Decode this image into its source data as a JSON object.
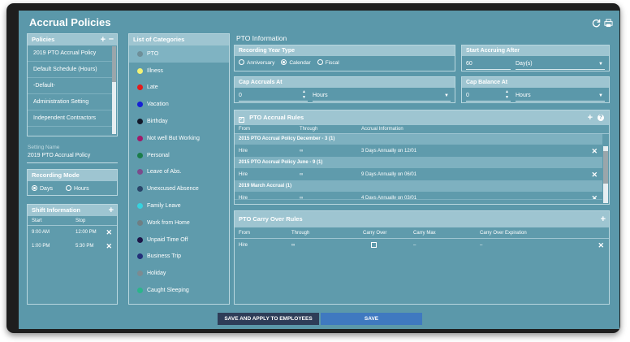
{
  "app": {
    "title": "Accrual Policies"
  },
  "policies": {
    "title": "Policies",
    "items": [
      "2019 PTO Accrual Policy",
      "Default Schedule (Hours)",
      "-Default-",
      "Administration Setting",
      "Independent Contractors"
    ]
  },
  "setting": {
    "label": "Setting Name",
    "value": "2019 PTO Accrual Policy"
  },
  "recording_mode": {
    "title": "Recording Mode",
    "options": [
      "Days",
      "Hours"
    ],
    "selected": "Days"
  },
  "shift_info": {
    "title": "Shift Information",
    "columns": [
      "Start",
      "Stop"
    ],
    "rows": [
      {
        "start": "9:00 AM",
        "stop": "12:00 PM"
      },
      {
        "start": "1:00 PM",
        "stop": "5:30 PM"
      }
    ]
  },
  "categories": {
    "title": "List of Categories",
    "items": [
      {
        "label": "PTO",
        "color": "#6e8f99"
      },
      {
        "label": "Illness",
        "color": "#f2f275"
      },
      {
        "label": "Late",
        "color": "#e41b1b"
      },
      {
        "label": "Vacation",
        "color": "#1520d6"
      },
      {
        "label": "Birthday",
        "color": "#121829"
      },
      {
        "label": "Not well But Working",
        "color": "#a01a6a"
      },
      {
        "label": "Personal",
        "color": "#1b7d4a"
      },
      {
        "label": "Leave of Abs.",
        "color": "#7b4b8c"
      },
      {
        "label": "Unexcused Absence",
        "color": "#2a466a"
      },
      {
        "label": "Family Leave",
        "color": "#35d3df"
      },
      {
        "label": "Work from Home",
        "color": "#6f7f84"
      },
      {
        "label": "Unpaid Time Off",
        "color": "#1d1648"
      },
      {
        "label": "Business Trip",
        "color": "#23307a"
      },
      {
        "label": "Holiday",
        "color": "#7c8b92"
      },
      {
        "label": "Caught Sleeping",
        "color": "#2bb58a"
      }
    ]
  },
  "pto_info": {
    "title": "PTO Information",
    "recording_year_type": {
      "label": "Recording Year Type",
      "options": [
        "Anniversary",
        "Calendar",
        "Fiscal"
      ],
      "selected": "Calendar"
    },
    "start_accruing_after": {
      "label": "Start Accruing After",
      "value": "60",
      "unit": "Day(s)"
    },
    "cap_accruals_at": {
      "label": "Cap Accruals At",
      "value": "0",
      "unit": "Hours"
    },
    "cap_balance_at": {
      "label": "Cap Balance At",
      "value": "0",
      "unit": "Hours"
    }
  },
  "accrual_rules": {
    "title": "PTO Accrual Rules",
    "columns": [
      "From",
      "Through",
      "Accrual Information"
    ],
    "groups": [
      {
        "name": "2015 PTO Accrual Policy December - 3 (1)",
        "from": "Hire",
        "through": "∞",
        "info": "3 Days Annually on 12/01"
      },
      {
        "name": "2015 PTO Accrual Policy June - 9 (1)",
        "from": "Hire",
        "through": "∞",
        "info": "9 Days Annually on 06/01"
      },
      {
        "name": "2019 March Accrual (1)",
        "from": "Hire",
        "through": "∞",
        "info": "4 Days Annually on 03/01"
      }
    ]
  },
  "carry_over": {
    "title": "PTO Carry Over Rules",
    "columns": [
      "From",
      "Through",
      "Carry Over",
      "Carry Max",
      "Carry Over Expiration"
    ],
    "rows": [
      {
        "from": "Hire",
        "through": "∞",
        "carry_max": "–",
        "expiration": "–"
      }
    ]
  },
  "buttons": {
    "apply": "SAVE AND APPLY TO EMPLOYEES",
    "save": "SAVE"
  }
}
